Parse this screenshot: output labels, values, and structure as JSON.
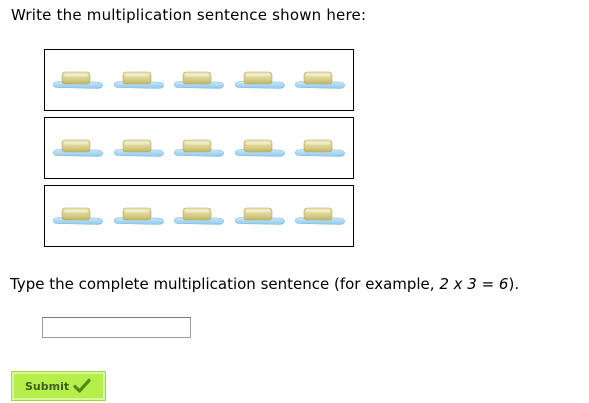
{
  "question": {
    "prompt": "Write the multiplication sentence shown here:",
    "instruction_prefix": "Type the complete multiplication sentence (for example, ",
    "instruction_example": "2 x 3 = 6",
    "instruction_suffix": ")."
  },
  "array_model": {
    "groups": 3,
    "items_per_group": 5,
    "item_icon": "butter-stick-on-dish-icon"
  },
  "answer": {
    "value": "",
    "placeholder": ""
  },
  "submit": {
    "label": "Submit",
    "icon": "checkmark-icon",
    "color": "#b6ee4a"
  }
}
